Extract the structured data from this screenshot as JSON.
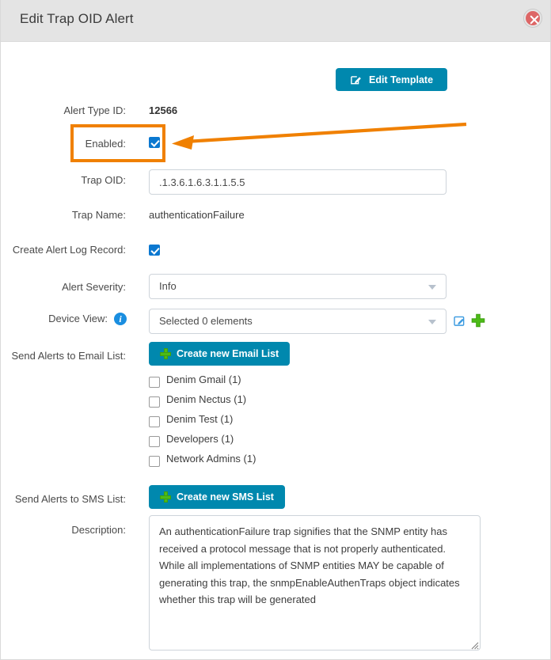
{
  "dialog": {
    "title": "Edit Trap OID Alert",
    "close_icon": "close-circle-icon"
  },
  "toolbar": {
    "edit_template_label": "Edit Template",
    "edit_template_icon": "pencil-square-icon"
  },
  "form": {
    "alert_type_id": {
      "label": "Alert Type ID:",
      "value": "12566"
    },
    "enabled": {
      "label": "Enabled:",
      "checked": true
    },
    "trap_oid": {
      "label": "Trap OID:",
      "value": ".1.3.6.1.6.3.1.1.5.5",
      "placeholder": ""
    },
    "trap_name": {
      "label": "Trap Name:",
      "value": "authenticationFailure"
    },
    "create_alert_log_record": {
      "label": "Create Alert Log Record:",
      "checked": true
    },
    "alert_severity": {
      "label": "Alert Severity:",
      "value": "Info"
    },
    "device_view": {
      "label": "Device View:",
      "value": "Selected 0 elements",
      "info_icon": "info-circle-icon",
      "edit_icon": "pencil-square-icon",
      "add_icon": "plus-icon"
    },
    "email_list": {
      "label": "Send Alerts to Email List:",
      "create_button_label": "Create new Email List",
      "create_button_icon": "plus-icon",
      "items": [
        {
          "label": "Denim Gmail (1)",
          "checked": false
        },
        {
          "label": "Denim Nectus (1)",
          "checked": false
        },
        {
          "label": "Denim Test (1)",
          "checked": false
        },
        {
          "label": "Developers (1)",
          "checked": false
        },
        {
          "label": "Network Admins (1)",
          "checked": false
        }
      ]
    },
    "sms_list": {
      "label": "Send Alerts to SMS List:",
      "create_button_label": "Create new SMS List",
      "create_button_icon": "plus-icon"
    },
    "description": {
      "label": "Description:",
      "value": "An authenticationFailure trap signifies that the SNMP entity has received a protocol message that is not properly authenticated. While all implementations of SNMP entities MAY be capable of generating this trap, the snmpEnableAuthenTraps object indicates whether this trap will be generated",
      "placeholder": ""
    }
  },
  "annotation": {
    "highlight_target": "enabled-checkbox",
    "color": "#f08000"
  },
  "colors": {
    "accent_teal": "#0088ae",
    "checkbox_blue": "#0b78d0",
    "plus_green": "#4cbb17",
    "info_blue": "#1a8ee0",
    "header_bg": "#e4e4e4",
    "close_red": "#dd6666",
    "annotation_orange": "#f08000"
  }
}
